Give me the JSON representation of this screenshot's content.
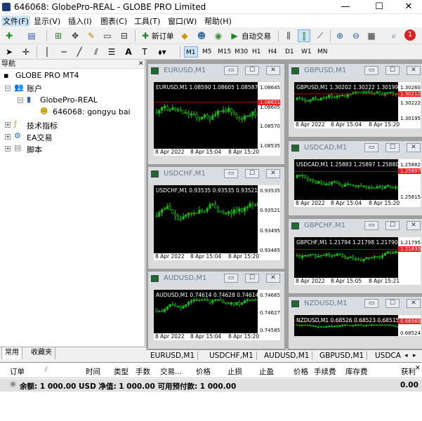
{
  "window": {
    "title": "646068: GlobePro-REAL - GLOBE PRO Limited",
    "minimize": "—",
    "maximize": "☐",
    "close": "✕"
  },
  "menu": [
    "文件(F)",
    "显示(V)",
    "插入(I)",
    "图表(C)",
    "工具(T)",
    "窗口(W)",
    "帮助(H)"
  ],
  "toolbar": {
    "new_order": "新订单",
    "auto_trading": "自动交易",
    "alert_badge": "1"
  },
  "timeframes": [
    "M1",
    "M5",
    "M15",
    "M30",
    "H1",
    "H4",
    "D1",
    "W1",
    "MN"
  ],
  "navigator": {
    "header": "导航",
    "root": "GLOBE PRO MT4",
    "accounts": "账户",
    "server": "GlobePro-REAL",
    "account": "646068: gongyu bai",
    "indicators": "技术指标",
    "experts": "EA交易",
    "scripts": "脚本",
    "tabs": [
      "常用",
      "收藏夹"
    ]
  },
  "charts": [
    {
      "title": "EURUSD,M1",
      "header": "EURUSD,M1  1.08590 1.08605 1.08587 1.08592",
      "prices": [
        "1.08645",
        "1.08605",
        "1.08570",
        "1.08535"
      ],
      "red_label": "1.08621",
      "dates": [
        "8 Apr 2022",
        "8 Apr 15:04",
        "8 Apr 15:20"
      ],
      "color": "#00d000"
    },
    {
      "title": "GBPUSD,M1",
      "header": "GBPUSD,M1  1.30202 1.30222 1.30199 1.30212",
      "prices": [
        "1.30260",
        "1.30222",
        "1.30195"
      ],
      "red_label": "1.30212",
      "dates": [
        "8 Apr 2022",
        "8 Apr 15:04",
        "8 Apr 15:20"
      ],
      "color": "#00d000"
    },
    {
      "title": "USDCHF,M1",
      "header": "USDCHF,M1  0.93535 0.93535 0.93521 0.93521",
      "prices": [
        "0.93535",
        "0.93521",
        "0.93495",
        "0.93465"
      ],
      "red_label": "",
      "dates": [
        "8 Apr 2022",
        "8 Apr 15:04",
        "8 Apr 15:20"
      ],
      "color": "#00d000"
    },
    {
      "title": "USDCAD,M1",
      "header": "USDCAD,M1  1.25883 1.25897 1.25880 1.25882",
      "prices": [
        "1.25882",
        "1.25815"
      ],
      "red_label": "1.25897",
      "dates": [
        "8 Apr 2022",
        "8 Apr 15:04",
        "8 Apr 15:20"
      ],
      "color": "#00d000"
    },
    {
      "title": "GBPCHF,M1",
      "header": "GBPCHF,M1  1.21794 1.21798 1.21790 1.21795",
      "prices": [
        "1.21795"
      ],
      "red_label": "1.21830",
      "dates": [
        "8 Apr 2022",
        "8 Apr 15:05",
        "8 Apr 15:21"
      ],
      "color": "#00d000"
    },
    {
      "title": "AUDUSD,M1",
      "header": "AUDUSD,M1  0.74614 0.74628 0.74614 0.74627",
      "prices": [
        "0.74665",
        "0.74627",
        "0.74585"
      ],
      "red_label": "",
      "dates": [
        "8 Apr 2022",
        "8 Apr 15:04",
        "8 Apr 15:20"
      ],
      "color": "#00d000"
    },
    {
      "title": "NZDUSD,M1",
      "header": "NZDUSD,M1  0.68526 0.68523 0.68515 0.68524",
      "prices": [
        "0.68540",
        "0.68524"
      ],
      "red_label": "0.68560",
      "dates": [
        "",
        "",
        ""
      ],
      "color": "#00d000"
    }
  ],
  "chart_tabs": [
    "EURUSD,M1",
    "USDCHF,M1",
    "AUDUSD,M1",
    "GBPUSD,M1",
    "USDCA"
  ],
  "terminal": {
    "columns": [
      "订单",
      "时间",
      "类型",
      "手数",
      "交易...",
      "价格",
      "止损",
      "止盈",
      "价格",
      "手续费",
      "库存费",
      "获利"
    ],
    "balance_row": "余额: 1 000.00 USD  净值: 1 000.00  可用预付款: 1 000.00",
    "profit": "0.00"
  }
}
